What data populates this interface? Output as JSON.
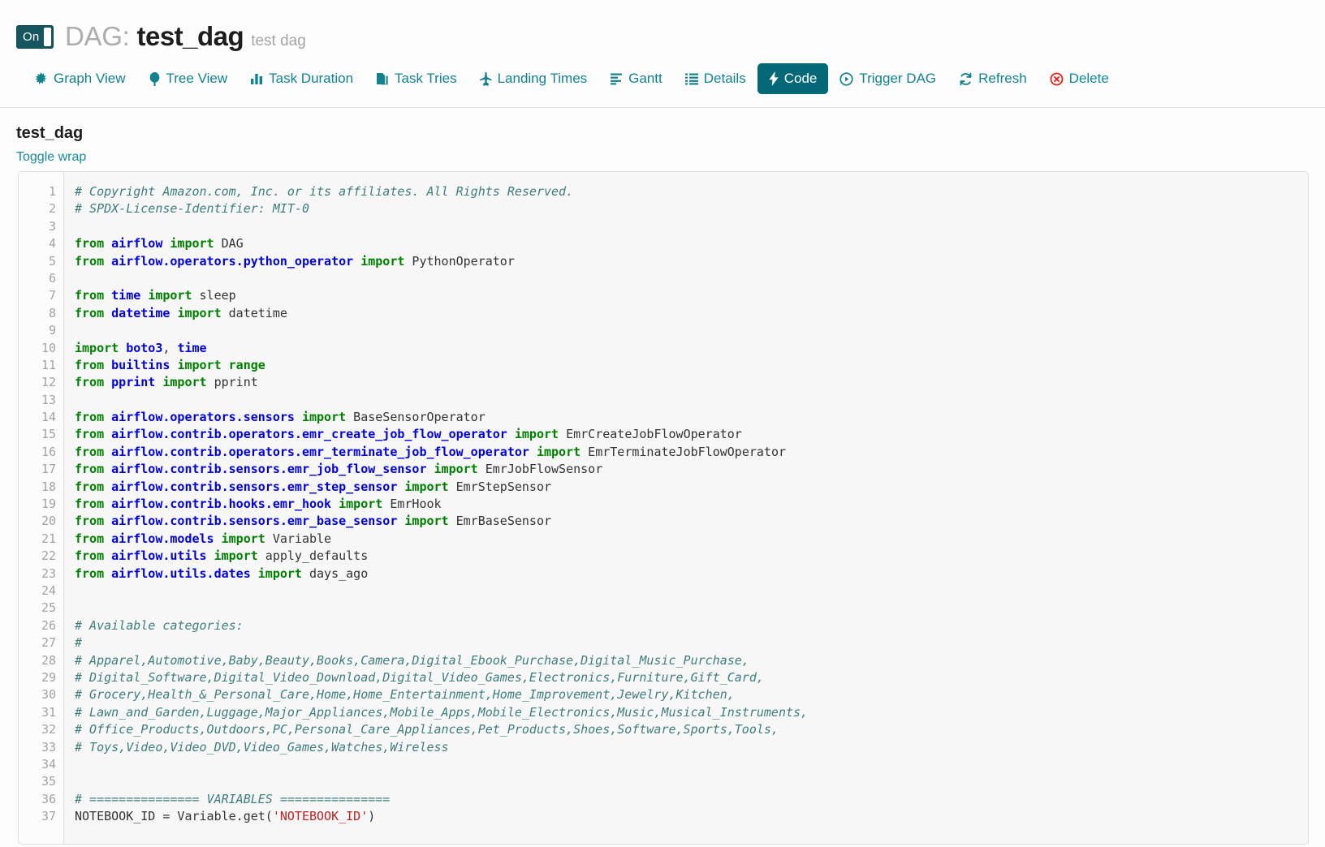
{
  "header": {
    "toggle_label": "On",
    "kicker": "DAG:",
    "dag_name": "test_dag",
    "description": "test dag"
  },
  "nav": {
    "items": [
      {
        "label": "Graph View",
        "icon": "asterisk-icon",
        "active": false
      },
      {
        "label": "Tree View",
        "icon": "tree-icon",
        "active": false
      },
      {
        "label": "Task Duration",
        "icon": "bar-chart-icon",
        "active": false
      },
      {
        "label": "Task Tries",
        "icon": "files-icon",
        "active": false
      },
      {
        "label": "Landing Times",
        "icon": "plane-icon",
        "active": false
      },
      {
        "label": "Gantt",
        "icon": "align-left-icon",
        "active": false
      },
      {
        "label": "Details",
        "icon": "list-icon",
        "active": false
      },
      {
        "label": "Code",
        "icon": "bolt-icon",
        "active": true
      },
      {
        "label": "Trigger DAG",
        "icon": "play-circle-icon",
        "active": false
      },
      {
        "label": "Refresh",
        "icon": "refresh-icon",
        "active": false
      },
      {
        "label": "Delete",
        "icon": "delete-circle-icon",
        "active": false
      }
    ]
  },
  "panel": {
    "title": "test_dag",
    "toggle_wrap_label": "Toggle wrap"
  },
  "colors": {
    "accent_teal": "#13828f",
    "active_tab_bg": "#046876",
    "toggle_on_bg": "#16565f",
    "delete_red": "#e8201a",
    "comment": "#3f7d7d",
    "keyword": "#008000",
    "namespace": "#0000dd",
    "string": "#bb2222"
  },
  "code": {
    "first_line_number": 1,
    "lines": [
      {
        "n": 1,
        "tokens": [
          {
            "t": "c",
            "v": "# Copyright Amazon.com, Inc. or its affiliates. All Rights Reserved."
          }
        ]
      },
      {
        "n": 2,
        "tokens": [
          {
            "t": "c",
            "v": "# SPDX-License-Identifier: MIT-0"
          }
        ]
      },
      {
        "n": 3,
        "tokens": []
      },
      {
        "n": 4,
        "tokens": [
          {
            "t": "k",
            "v": "from"
          },
          {
            "t": "p",
            "v": " "
          },
          {
            "t": "nn",
            "v": "airflow"
          },
          {
            "t": "p",
            "v": " "
          },
          {
            "t": "k",
            "v": "import"
          },
          {
            "t": "n",
            "v": " DAG"
          }
        ]
      },
      {
        "n": 5,
        "tokens": [
          {
            "t": "k",
            "v": "from"
          },
          {
            "t": "p",
            "v": " "
          },
          {
            "t": "nn",
            "v": "airflow.operators.python_operator"
          },
          {
            "t": "p",
            "v": " "
          },
          {
            "t": "k",
            "v": "import"
          },
          {
            "t": "n",
            "v": " PythonOperator"
          }
        ]
      },
      {
        "n": 6,
        "tokens": []
      },
      {
        "n": 7,
        "tokens": [
          {
            "t": "k",
            "v": "from"
          },
          {
            "t": "p",
            "v": " "
          },
          {
            "t": "nn",
            "v": "time"
          },
          {
            "t": "p",
            "v": " "
          },
          {
            "t": "k",
            "v": "import"
          },
          {
            "t": "n",
            "v": " sleep"
          }
        ]
      },
      {
        "n": 8,
        "tokens": [
          {
            "t": "k",
            "v": "from"
          },
          {
            "t": "p",
            "v": " "
          },
          {
            "t": "nn",
            "v": "datetime"
          },
          {
            "t": "p",
            "v": " "
          },
          {
            "t": "k",
            "v": "import"
          },
          {
            "t": "n",
            "v": " datetime"
          }
        ]
      },
      {
        "n": 9,
        "tokens": []
      },
      {
        "n": 10,
        "tokens": [
          {
            "t": "k",
            "v": "import"
          },
          {
            "t": "p",
            "v": " "
          },
          {
            "t": "nn",
            "v": "boto3"
          },
          {
            "t": "p",
            "v": ", "
          },
          {
            "t": "nn",
            "v": "time"
          }
        ]
      },
      {
        "n": 11,
        "tokens": [
          {
            "t": "k",
            "v": "from"
          },
          {
            "t": "p",
            "v": " "
          },
          {
            "t": "nn",
            "v": "builtins"
          },
          {
            "t": "p",
            "v": " "
          },
          {
            "t": "k",
            "v": "import"
          },
          {
            "t": "k",
            "v": " range"
          }
        ]
      },
      {
        "n": 12,
        "tokens": [
          {
            "t": "k",
            "v": "from"
          },
          {
            "t": "p",
            "v": " "
          },
          {
            "t": "nn",
            "v": "pprint"
          },
          {
            "t": "p",
            "v": " "
          },
          {
            "t": "k",
            "v": "import"
          },
          {
            "t": "n",
            "v": " pprint"
          }
        ]
      },
      {
        "n": 13,
        "tokens": []
      },
      {
        "n": 14,
        "tokens": [
          {
            "t": "k",
            "v": "from"
          },
          {
            "t": "p",
            "v": " "
          },
          {
            "t": "nn",
            "v": "airflow.operators.sensors"
          },
          {
            "t": "p",
            "v": " "
          },
          {
            "t": "k",
            "v": "import"
          },
          {
            "t": "n",
            "v": " BaseSensorOperator"
          }
        ]
      },
      {
        "n": 15,
        "tokens": [
          {
            "t": "k",
            "v": "from"
          },
          {
            "t": "p",
            "v": " "
          },
          {
            "t": "nn",
            "v": "airflow.contrib.operators.emr_create_job_flow_operator"
          },
          {
            "t": "p",
            "v": " "
          },
          {
            "t": "k",
            "v": "import"
          },
          {
            "t": "n",
            "v": " EmrCreateJobFlowOperator"
          }
        ]
      },
      {
        "n": 16,
        "tokens": [
          {
            "t": "k",
            "v": "from"
          },
          {
            "t": "p",
            "v": " "
          },
          {
            "t": "nn",
            "v": "airflow.contrib.operators.emr_terminate_job_flow_operator"
          },
          {
            "t": "p",
            "v": " "
          },
          {
            "t": "k",
            "v": "import"
          },
          {
            "t": "n",
            "v": " EmrTerminateJobFlowOperator"
          }
        ]
      },
      {
        "n": 17,
        "tokens": [
          {
            "t": "k",
            "v": "from"
          },
          {
            "t": "p",
            "v": " "
          },
          {
            "t": "nn",
            "v": "airflow.contrib.sensors.emr_job_flow_sensor"
          },
          {
            "t": "p",
            "v": " "
          },
          {
            "t": "k",
            "v": "import"
          },
          {
            "t": "n",
            "v": " EmrJobFlowSensor"
          }
        ]
      },
      {
        "n": 18,
        "tokens": [
          {
            "t": "k",
            "v": "from"
          },
          {
            "t": "p",
            "v": " "
          },
          {
            "t": "nn",
            "v": "airflow.contrib.sensors.emr_step_sensor"
          },
          {
            "t": "p",
            "v": " "
          },
          {
            "t": "k",
            "v": "import"
          },
          {
            "t": "n",
            "v": " EmrStepSensor"
          }
        ]
      },
      {
        "n": 19,
        "tokens": [
          {
            "t": "k",
            "v": "from"
          },
          {
            "t": "p",
            "v": " "
          },
          {
            "t": "nn",
            "v": "airflow.contrib.hooks.emr_hook"
          },
          {
            "t": "p",
            "v": " "
          },
          {
            "t": "k",
            "v": "import"
          },
          {
            "t": "n",
            "v": " EmrHook"
          }
        ]
      },
      {
        "n": 20,
        "tokens": [
          {
            "t": "k",
            "v": "from"
          },
          {
            "t": "p",
            "v": " "
          },
          {
            "t": "nn",
            "v": "airflow.contrib.sensors.emr_base_sensor"
          },
          {
            "t": "p",
            "v": " "
          },
          {
            "t": "k",
            "v": "import"
          },
          {
            "t": "n",
            "v": " EmrBaseSensor"
          }
        ]
      },
      {
        "n": 21,
        "tokens": [
          {
            "t": "k",
            "v": "from"
          },
          {
            "t": "p",
            "v": " "
          },
          {
            "t": "nn",
            "v": "airflow.models"
          },
          {
            "t": "p",
            "v": " "
          },
          {
            "t": "k",
            "v": "import"
          },
          {
            "t": "n",
            "v": " Variable"
          }
        ]
      },
      {
        "n": 22,
        "tokens": [
          {
            "t": "k",
            "v": "from"
          },
          {
            "t": "p",
            "v": " "
          },
          {
            "t": "nn",
            "v": "airflow.utils"
          },
          {
            "t": "p",
            "v": " "
          },
          {
            "t": "k",
            "v": "import"
          },
          {
            "t": "n",
            "v": " apply_defaults"
          }
        ]
      },
      {
        "n": 23,
        "tokens": [
          {
            "t": "k",
            "v": "from"
          },
          {
            "t": "p",
            "v": " "
          },
          {
            "t": "nn",
            "v": "airflow.utils.dates"
          },
          {
            "t": "p",
            "v": " "
          },
          {
            "t": "k",
            "v": "import"
          },
          {
            "t": "n",
            "v": " days_ago"
          }
        ]
      },
      {
        "n": 24,
        "tokens": []
      },
      {
        "n": 25,
        "tokens": []
      },
      {
        "n": 26,
        "tokens": [
          {
            "t": "c",
            "v": "# Available categories:"
          }
        ]
      },
      {
        "n": 27,
        "tokens": [
          {
            "t": "c",
            "v": "#"
          }
        ]
      },
      {
        "n": 28,
        "tokens": [
          {
            "t": "c",
            "v": "# Apparel,Automotive,Baby,Beauty,Books,Camera,Digital_Ebook_Purchase,Digital_Music_Purchase,"
          }
        ]
      },
      {
        "n": 29,
        "tokens": [
          {
            "t": "c",
            "v": "# Digital_Software,Digital_Video_Download,Digital_Video_Games,Electronics,Furniture,Gift_Card,"
          }
        ]
      },
      {
        "n": 30,
        "tokens": [
          {
            "t": "c",
            "v": "# Grocery,Health_&_Personal_Care,Home,Home_Entertainment,Home_Improvement,Jewelry,Kitchen,"
          }
        ]
      },
      {
        "n": 31,
        "tokens": [
          {
            "t": "c",
            "v": "# Lawn_and_Garden,Luggage,Major_Appliances,Mobile_Apps,Mobile_Electronics,Music,Musical_Instruments,"
          }
        ]
      },
      {
        "n": 32,
        "tokens": [
          {
            "t": "c",
            "v": "# Office_Products,Outdoors,PC,Personal_Care_Appliances,Pet_Products,Shoes,Software,Sports,Tools,"
          }
        ]
      },
      {
        "n": 33,
        "tokens": [
          {
            "t": "c",
            "v": "# Toys,Video,Video_DVD,Video_Games,Watches,Wireless"
          }
        ]
      },
      {
        "n": 34,
        "tokens": []
      },
      {
        "n": 35,
        "tokens": []
      },
      {
        "n": 36,
        "tokens": [
          {
            "t": "c",
            "v": "# =============== VARIABLES ==============="
          }
        ]
      },
      {
        "n": 37,
        "tokens": [
          {
            "t": "n",
            "v": "NOTEBOOK_ID = Variable.get("
          },
          {
            "t": "s",
            "v": "'NOTEBOOK_ID'"
          },
          {
            "t": "n",
            "v": ")"
          }
        ]
      }
    ]
  }
}
